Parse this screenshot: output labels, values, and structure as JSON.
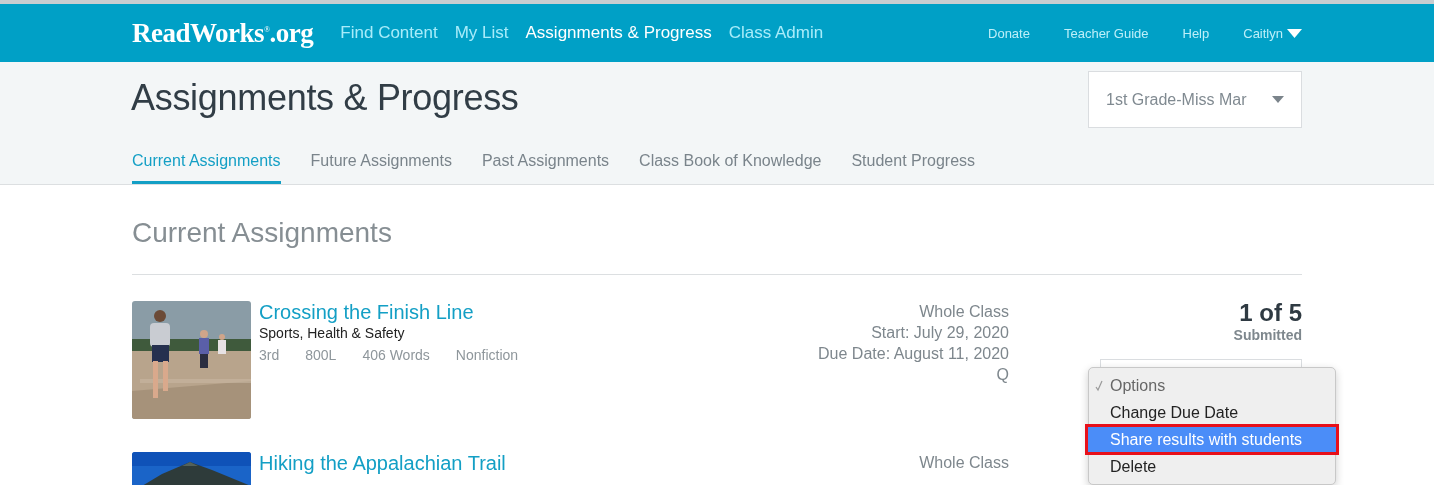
{
  "header": {
    "logo": "ReadWorks$^{®}$.org",
    "nav": [
      {
        "label": "Find Content",
        "selected": false
      },
      {
        "label": "My List",
        "selected": false
      },
      {
        "label": "Assignments & Progress",
        "selected": true
      },
      {
        "label": "Class Admin",
        "selected": false
      }
    ],
    "links": [
      "Donate",
      "Teacher Guide",
      "Help"
    ],
    "user": "Caitlyn"
  },
  "page": {
    "title": "Assignments & Progress",
    "class_select": "1st Grade-Miss Mar"
  },
  "tabs": [
    {
      "label": "Current Assignments",
      "selected": true
    },
    {
      "label": "Future Assignments",
      "selected": false
    },
    {
      "label": "Past Assignments",
      "selected": false
    },
    {
      "label": "Class Book of Knowledge",
      "selected": false
    },
    {
      "label": "Student Progress",
      "selected": false
    }
  ],
  "section_title": "Current Assignments",
  "assignments": [
    {
      "title": "Crossing the Finish Line",
      "topics": "Sports, Health & Safety",
      "meta": [
        "3rd",
        "800L",
        "406 Words",
        "Nonfiction"
      ],
      "picture": {
        "kind": "picture"
      },
      "info": [
        "Whole Class",
        "Start: July 29, 2020",
        "Due Date: August 11, 2020",
        "Q"
      ],
      "count": "1 of 5",
      "count_label": "Submitted"
    },
    {
      "title": "Hiking the Appalachian Trail",
      "picture": {
        "kind": "picture"
      },
      "info": [
        "Whole Class"
      ]
    }
  ],
  "options_menu": [
    {
      "label": "Options",
      "checked": true,
      "highlighted": false,
      "outlined": false
    },
    {
      "label": "Change Due Date",
      "checked": false,
      "highlighted": false,
      "outlined": false
    },
    {
      "label": "Share results with students",
      "checked": false,
      "highlighted": true,
      "outlined": true
    },
    {
      "label": "Delete",
      "checked": false,
      "highlighted": false,
      "outlined": false
    }
  ]
}
